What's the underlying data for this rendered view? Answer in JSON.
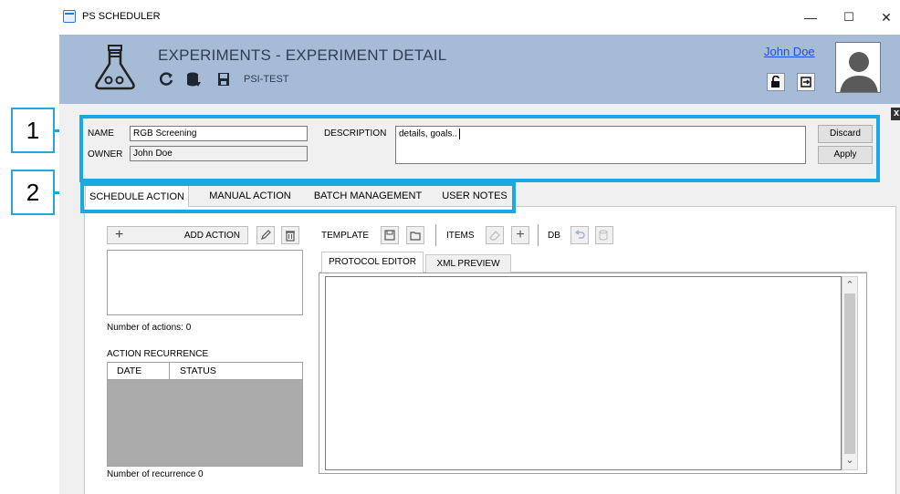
{
  "window": {
    "title": "PS SCHEDULER",
    "controls": {
      "minimize": "—",
      "maximize": "☐",
      "close": "✕"
    }
  },
  "header": {
    "title": "EXPERIMENTS - EXPERIMENT DETAIL",
    "environment": "PSI-TEST",
    "user_name": "John Doe",
    "icons": [
      "flask-icon",
      "refresh-icon",
      "database-icon",
      "save-icon",
      "unlock-icon",
      "logout-icon"
    ]
  },
  "details": {
    "name_label": "NAME",
    "name_value": "RGB Screening",
    "owner_label": "OWNER",
    "owner_value": "John Doe",
    "description_label": "DESCRIPTION",
    "description_value": "details, goals..",
    "discard_label": "Discard",
    "apply_label": "Apply",
    "close_glyph": "x"
  },
  "callouts": {
    "one": "1",
    "two": "2"
  },
  "tabs": [
    {
      "label": "SCHEDULE ACTION",
      "active": true
    },
    {
      "label": "MANUAL ACTION",
      "active": false
    },
    {
      "label": "BATCH MANAGEMENT",
      "active": false
    },
    {
      "label": "USER NOTES",
      "active": false
    }
  ],
  "schedule": {
    "add_symbol": "+",
    "add_action_label": "ADD ACTION",
    "actions_count_label": "Number of actions: 0",
    "recurrence_title": "ACTION RECURRENCE",
    "recurrence_columns": [
      "DATE",
      "STATUS"
    ],
    "recurrence_count_label": "Number of recurrence 0"
  },
  "toolbar": {
    "template_label": "TEMPLATE",
    "items_label": "ITEMS",
    "items_add_symbol": "+",
    "db_label": "DB"
  },
  "editor": {
    "tabs": [
      {
        "label": "PROTOCOL EDITOR",
        "active": true
      },
      {
        "label": "XML PREVIEW",
        "active": false
      }
    ],
    "scroll_up": "⌃",
    "scroll_down": "⌄"
  },
  "colors": {
    "header_bg": "#a6bcd6",
    "callout_blue": "#1aa9e0",
    "link_blue": "#1f4fd6"
  }
}
